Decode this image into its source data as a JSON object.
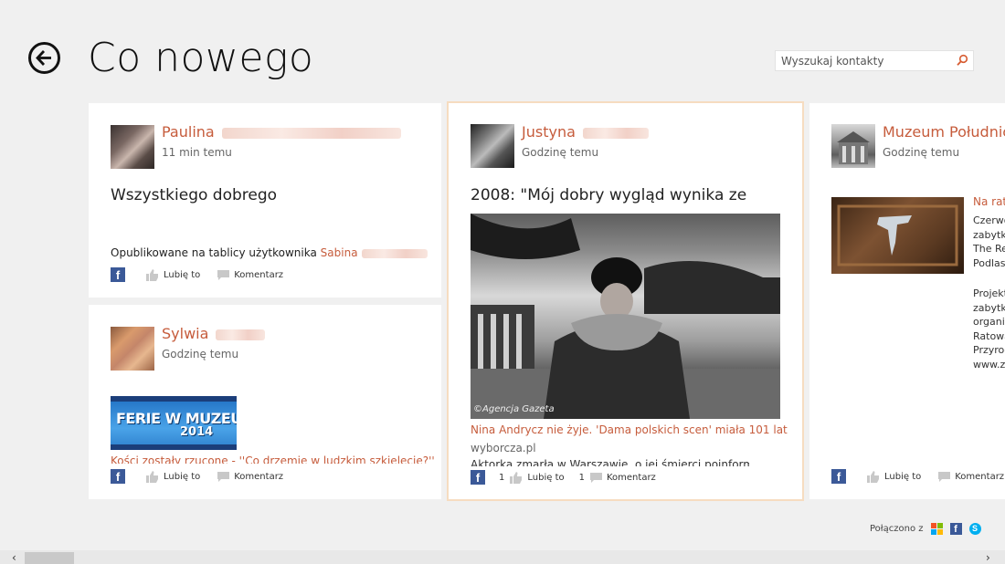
{
  "header": {
    "title": "Co nowego"
  },
  "search": {
    "placeholder": "Wyszukaj kontakty"
  },
  "icons": {
    "back": "back-arrow-icon",
    "search": "search-icon",
    "like": "thumbs-up-icon",
    "comment": "comment-icon",
    "facebook": "facebook-icon"
  },
  "colors": {
    "accent": "#c65c3c",
    "facebook": "#3b5998",
    "skype": "#00aff0",
    "selected_border": "#f6dcc0"
  },
  "posts": [
    {
      "name": "Paulina",
      "time": "11 min temu",
      "message": "Wszystkiego dobrego",
      "posted_prefix": "Opublikowane na tablicy użytkownika",
      "posted_user": "Sabina",
      "like_label": "Lubię to",
      "comment_label": "Komentarz"
    },
    {
      "name": "Sylwia",
      "time": "Godzinę temu",
      "image_lines": [
        "FERIE W MUZEUM",
        "2014"
      ],
      "link_title": "Kości zostały rzucone - ''Co drzemie w ludzkim szkielecie?''",
      "like_label": "Lubię to",
      "comment_label": "Komentarz"
    },
    {
      "name": "Justyna",
      "time": "Godzinę temu",
      "message": "2008: \"Mój dobry wygląd wynika ze",
      "image_credit": "©Agencja Gazeta",
      "link_title": "Nina Andrycz nie żyje. 'Dama polskich scen' miała 101 lat",
      "link_domain": "wyborcza.pl",
      "description": "Aktorka zmarła w Warszawie, o jej śmierci poinformowało",
      "like_count": "1",
      "like_label": "Lubię to",
      "comment_count": "1",
      "comment_label": "Komentarz"
    },
    {
      "name": "Muzeum Południc",
      "time": "Godzinę temu",
      "side_title": "Na ratu",
      "side_lines": [
        "Czerwo",
        "zabytk",
        "The Re",
        "Podlas"
      ],
      "side_lines2": [
        "Projekt",
        "zabytk",
        "organiz",
        "Ratowa",
        "Przyroc",
        "www.za"
      ],
      "like_label": "Lubię to",
      "comment_label": "Komentarz"
    }
  ],
  "footer": {
    "connected_label": "Połączono z"
  }
}
